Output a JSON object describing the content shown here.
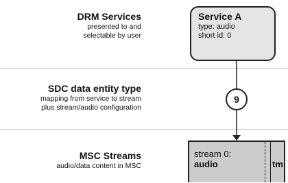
{
  "rows": {
    "services": {
      "title": "DRM Services",
      "subtitle": [
        "presented to and",
        "selectable by user"
      ]
    },
    "sdc": {
      "title": "SDC data entity type",
      "subtitle": [
        "mapping from service to stream",
        "plus stream/audio configuration"
      ]
    },
    "msc": {
      "title": "MSC Streams",
      "subtitle": [
        "audio/data content in MSC"
      ]
    }
  },
  "service_box": {
    "name": "Service A",
    "type_line": "type: audio",
    "id_line": "short id: 0"
  },
  "entity_badge": {
    "label": "9"
  },
  "stream_box": {
    "line1": "stream 0:",
    "line2": "audio",
    "tag": "tm"
  },
  "colors": {
    "service_fill": "#e5e5e5",
    "stream_fill": "#cccccc",
    "stroke": "#222222",
    "divider": "#bdbdbd"
  }
}
